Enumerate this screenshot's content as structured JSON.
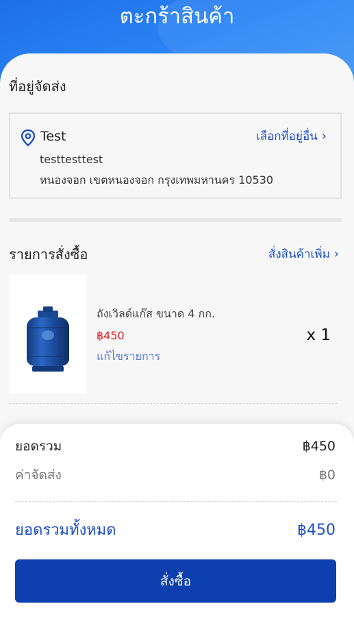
{
  "header": {
    "title": "ตะกร้าสินค้า"
  },
  "shipping": {
    "section_title": "ที่อยู่จัดส่ง",
    "name": "Test",
    "change_label": "เลือกที่อยู่อื่น",
    "line1": "testtesttest",
    "line2": "หนองจอก เขตหนองจอก กรุงเทพมหานคร 10530"
  },
  "orders": {
    "section_title": "รายการสั่งซื้อ",
    "more_label": "สั่งสินค้าเพิ่ม",
    "items": [
      {
        "name": "ถังเวิลด์แก๊ส ขนาด 4 กก.",
        "price": "฿450",
        "edit_label": "แก้ไขรายการ",
        "qty": "x 1"
      }
    ]
  },
  "summary": {
    "subtotal_label": "ยอดรวม",
    "subtotal_value": "฿450",
    "shipping_label": "ค่าจัดส่ง",
    "shipping_value": "฿0",
    "total_label": "ยอดรวมทั้งหมด",
    "total_value": "฿450",
    "order_button": "สั่งซื้อ"
  },
  "colors": {
    "header_blue": "#1f7bf0",
    "accent_blue": "#1e4fc2",
    "button_blue": "#0d3fae",
    "price_red": "#e02020"
  },
  "icons": [
    "map-pin-icon",
    "chevron-right-icon",
    "gas-cylinder-image"
  ]
}
